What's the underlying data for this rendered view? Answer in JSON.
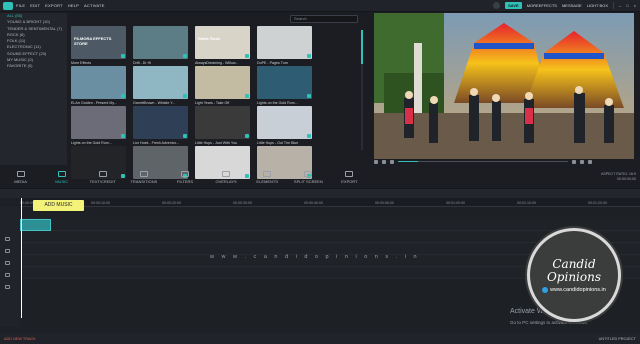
{
  "menubar": {
    "items": [
      "FILE",
      "EDIT",
      "EXPORT",
      "HELP",
      "ACTIVATE"
    ]
  },
  "topright": {
    "save": "SAVE",
    "more_effects": "MOREEFFECTS",
    "message": "MESSAGE",
    "lightbox": "LIGHT BOX"
  },
  "sidebar": {
    "items": [
      {
        "label": "ALL (55)"
      },
      {
        "label": "YOUNG & BRIGHT (10)"
      },
      {
        "label": "TENDER & SENTIMENTAL (7)"
      },
      {
        "label": "ROCK (6)"
      },
      {
        "label": "FOLK (11)"
      },
      {
        "label": "ELECTRONIC (11)"
      },
      {
        "label": "SOUND EFFECT (20)"
      },
      {
        "label": "MY MUSIC (0)"
      },
      {
        "label": "FAVORITE (0)"
      }
    ]
  },
  "search": {
    "placeholder": "Search"
  },
  "library": {
    "items": [
      {
        "label": "More Effects",
        "bg": "#4d5a66",
        "text": "FILMORA EFFECTS STORE"
      },
      {
        "label": "Drift - Dr Hi",
        "bg": "#5c7d86",
        "text": ""
      },
      {
        "label": "AlwaysDreaming - Willow...",
        "bg": "#d9d4c8",
        "text": "White Rush"
      },
      {
        "label": "DoPE - Pages Turn",
        "bg": "#cfd2d3",
        "text": ""
      },
      {
        "label": "ELArr Golden - Present My...",
        "bg": "#6a8fa3",
        "text": ""
      },
      {
        "label": "GarrettBrown - Whistle Y...",
        "bg": "#8fb6c3",
        "text": ""
      },
      {
        "label": "Light Years - Take Off",
        "bg": "#c4bca2",
        "text": ""
      },
      {
        "label": "Lights on the Gold Rum...",
        "bg": "#2e5d73",
        "text": ""
      },
      {
        "label": "Lights on the Gold Rum...",
        "bg": "#6c6b78",
        "text": ""
      },
      {
        "label": "Lior Hoek - Fresh Adventur...",
        "bg": "#2f3f56",
        "text": ""
      },
      {
        "label": "Little Hups - Just With You",
        "bg": "#3b3a3a",
        "text": ""
      },
      {
        "label": "Little Hups - Out The Blue",
        "bg": "#c9cfd6",
        "text": ""
      },
      {
        "label": "",
        "bg": "#222428",
        "text": ""
      },
      {
        "label": "",
        "bg": "#5f6468",
        "text": ""
      },
      {
        "label": "",
        "bg": "#d8d8d8",
        "text": ""
      },
      {
        "label": "",
        "bg": "#b7b1a8",
        "text": ""
      }
    ]
  },
  "tabs": [
    {
      "label": "MEDIA"
    },
    {
      "label": "MUSIC"
    },
    {
      "label": "TEXT/CREDIT"
    },
    {
      "label": "TRANSITIONS"
    },
    {
      "label": "FILTERS"
    },
    {
      "label": "OVERLAYS"
    },
    {
      "label": "ELEMENTS"
    },
    {
      "label": "SPLIT SCREEN"
    },
    {
      "label": "EXPORT"
    }
  ],
  "preview": {
    "progress": 0.12,
    "aspect": "ASPECT RATIO: 16:9",
    "time": "00:00:00:00"
  },
  "timeline": {
    "ticks": [
      "00:00:00:00",
      "00:00:10:00",
      "00:00:20:00",
      "00:00:30:00",
      "00:00:40:00",
      "00:00:50:00",
      "00:01:00:00",
      "00:01:10:00",
      "00:01:20:00"
    ],
    "tooltip": "ADD MUSIC",
    "add_track": "ADD NEW TRACK",
    "project": "UNTITLED PROJECT"
  },
  "watermark": "w w w . c a n d i d o p i n i o n s . i n",
  "activation": {
    "title": "Activate Windows",
    "subtitle": "Go to PC settings to activate Windows."
  },
  "badge": {
    "line1": "Candid",
    "line2": "Opinions",
    "url": "www.candidopinions.in"
  }
}
